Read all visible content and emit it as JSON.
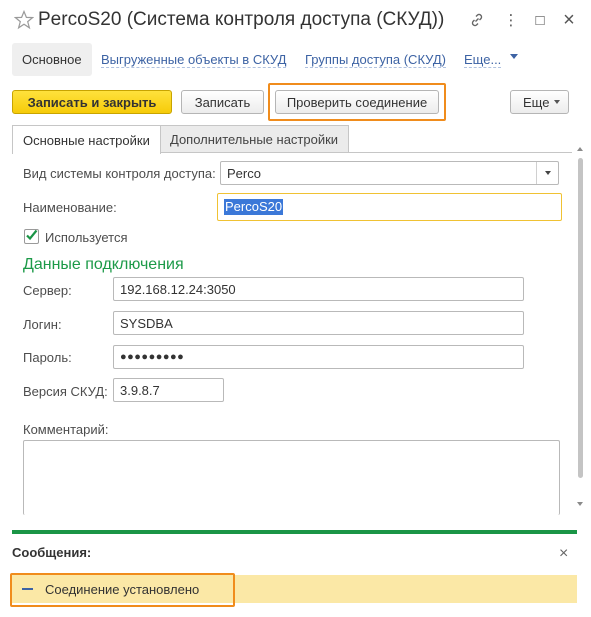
{
  "window": {
    "title": "PercoS20 (Система контроля доступа (СКУД))",
    "controls": {
      "link": "🔗",
      "more": "⋮",
      "maximize": "□",
      "close": "×"
    }
  },
  "nav": {
    "main": "Основное",
    "links": [
      "Выгруженные объекты в СКУД",
      "Группы доступа (СКУД)",
      "Еще..."
    ]
  },
  "toolbar": {
    "save_close": "Записать и закрыть",
    "save": "Записать",
    "check_connection": "Проверить соединение",
    "more": "Еще"
  },
  "tabs": [
    "Основные настройки",
    "Дополнительные настройки"
  ],
  "form": {
    "system_type_label": "Вид системы контроля доступа:",
    "system_type_value": "Perco",
    "name_label": "Наименование:",
    "name_value": "PercoS20",
    "used_label": "Используется",
    "used_checked": true,
    "connection_section": "Данные подключения",
    "server_label": "Сервер:",
    "server_value": "192.168.12.24:3050",
    "login_label": "Логин:",
    "login_value": "SYSDBA",
    "password_label": "Пароль:",
    "password_value": "●●●●●●●●●",
    "version_label": "Версия СКУД:",
    "version_value": "3.9.8.7",
    "comment_label": "Комментарий:",
    "comment_value": ""
  },
  "messages": {
    "title": "Сообщения:",
    "close": "×",
    "items": [
      {
        "text": "Соединение установлено"
      }
    ]
  },
  "colors": {
    "accent_green": "#1a9546",
    "primary_yellow": "#f6cb09",
    "highlight_orange": "#f08c1c",
    "link_blue": "#3d63a4",
    "message_bg": "#fbe8a6"
  }
}
